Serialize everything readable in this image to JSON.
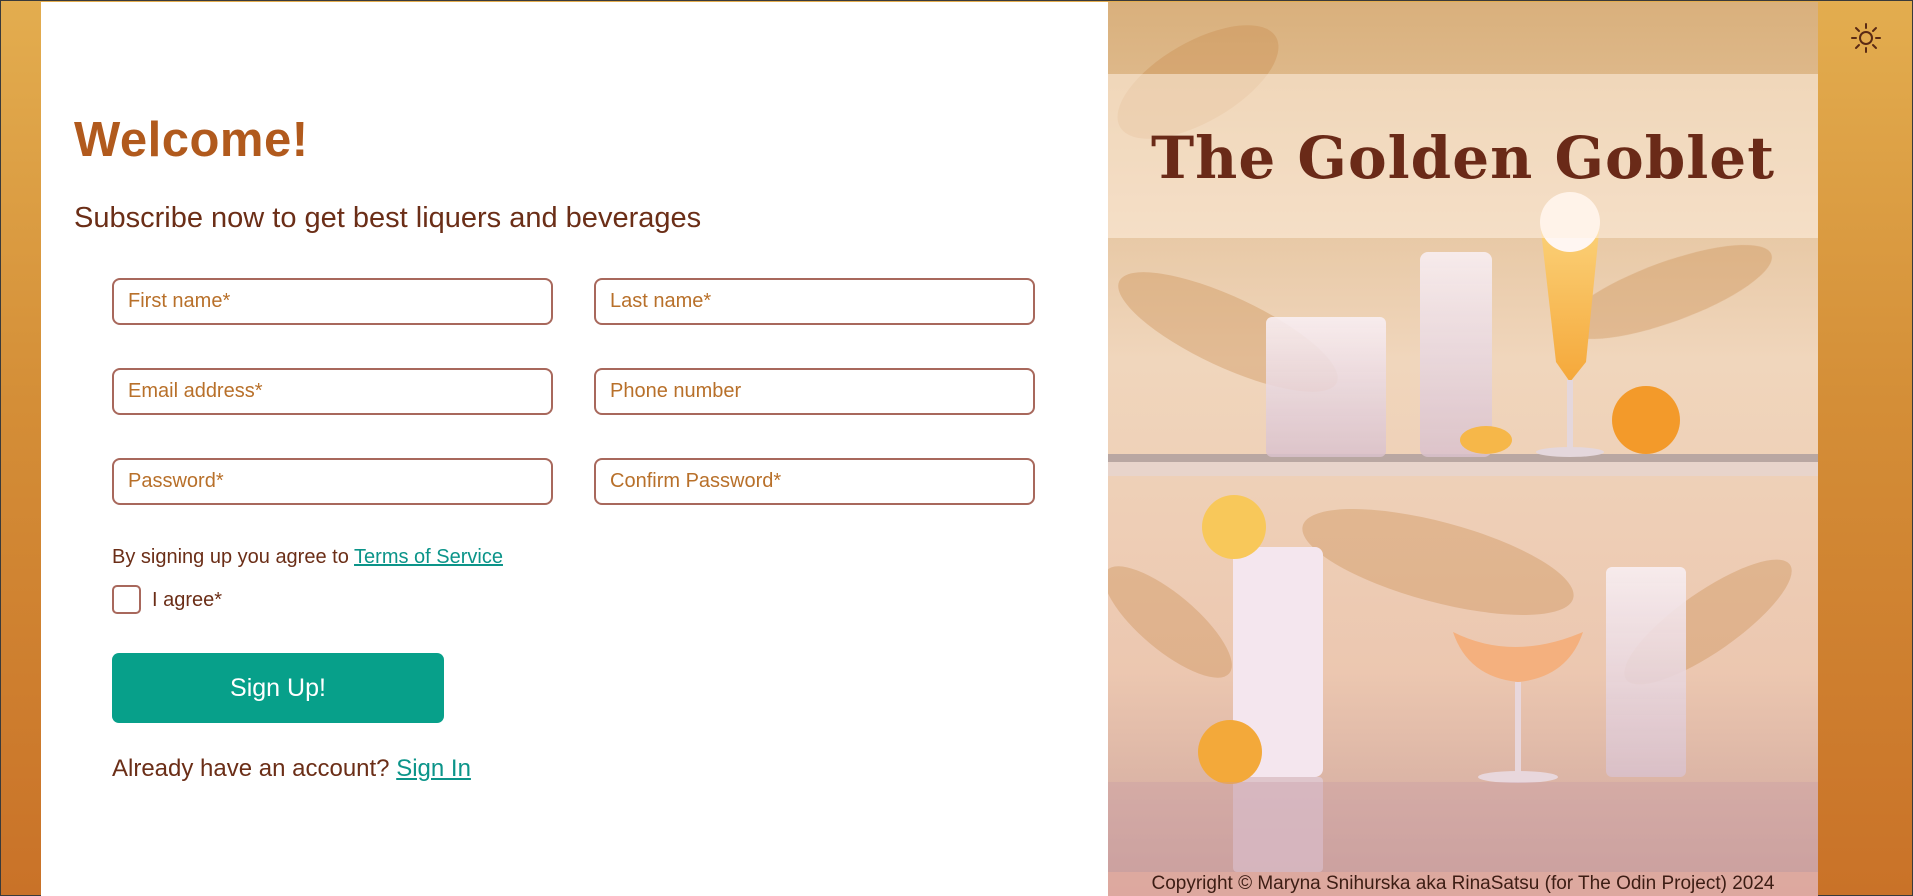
{
  "form": {
    "heading": "Welcome!",
    "subheading": "Subscribe now to get best liquers and beverages",
    "fields": {
      "first_name": "First name*",
      "last_name": "Last name*",
      "email": "Email address*",
      "phone": "Phone number",
      "password": "Password*",
      "confirm_password": "Confirm Password*"
    },
    "terms_text": "By signing up you agree to ",
    "terms_link": "Terms of Service",
    "agree_label": "I agree*",
    "signup_button": "Sign Up!",
    "account_text": "Already have an account? ",
    "signin_link": "Sign In"
  },
  "hero": {
    "title": "The Golden Goblet",
    "copyright": "Copyright © Maryna Snihurska aka RinaSatsu (for The Odin Project) 2024"
  },
  "icons": {
    "theme_toggle": "sun-icon"
  },
  "colors": {
    "accent": "#b15a1d",
    "text": "#6b2e17",
    "button": "#07a08a",
    "link": "#0b9489",
    "input_border": "#a8685c",
    "background_top": "#e3ad4f",
    "background_bottom": "#c97228"
  }
}
